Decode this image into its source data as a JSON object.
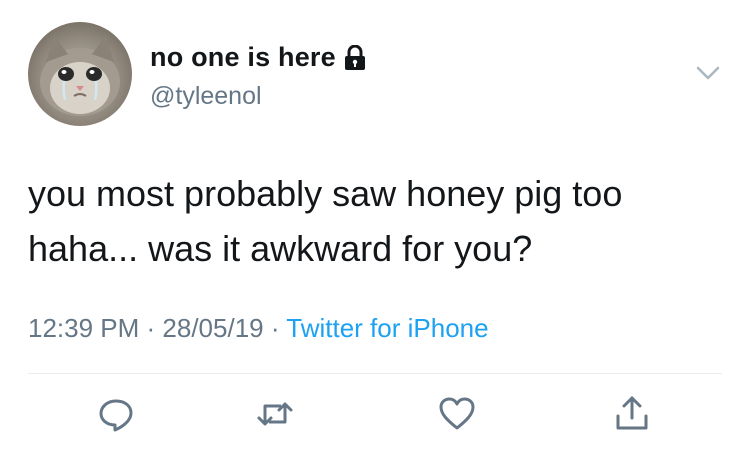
{
  "tweet": {
    "author": {
      "display_name": "no one is here",
      "handle": "@tyleenol",
      "avatar_icon": "crying-cat-avatar",
      "protected_icon": "lock-icon"
    },
    "text_line1": "you most probably saw honey pig too",
    "text_line2": "haha... was it awkward for you?",
    "time": "12:39 PM",
    "date": "28/05/19",
    "separator": " · ",
    "source": "Twitter for iPhone"
  },
  "actions": [
    {
      "name": "reply",
      "icon": "reply-icon"
    },
    {
      "name": "retweet",
      "icon": "retweet-icon"
    },
    {
      "name": "like",
      "icon": "heart-icon"
    },
    {
      "name": "share",
      "icon": "share-icon"
    }
  ],
  "colors": {
    "text": "#14171a",
    "secondary": "#657786",
    "link": "#1da1f2",
    "divider": "#e6ecf0",
    "icon": "#657786"
  }
}
